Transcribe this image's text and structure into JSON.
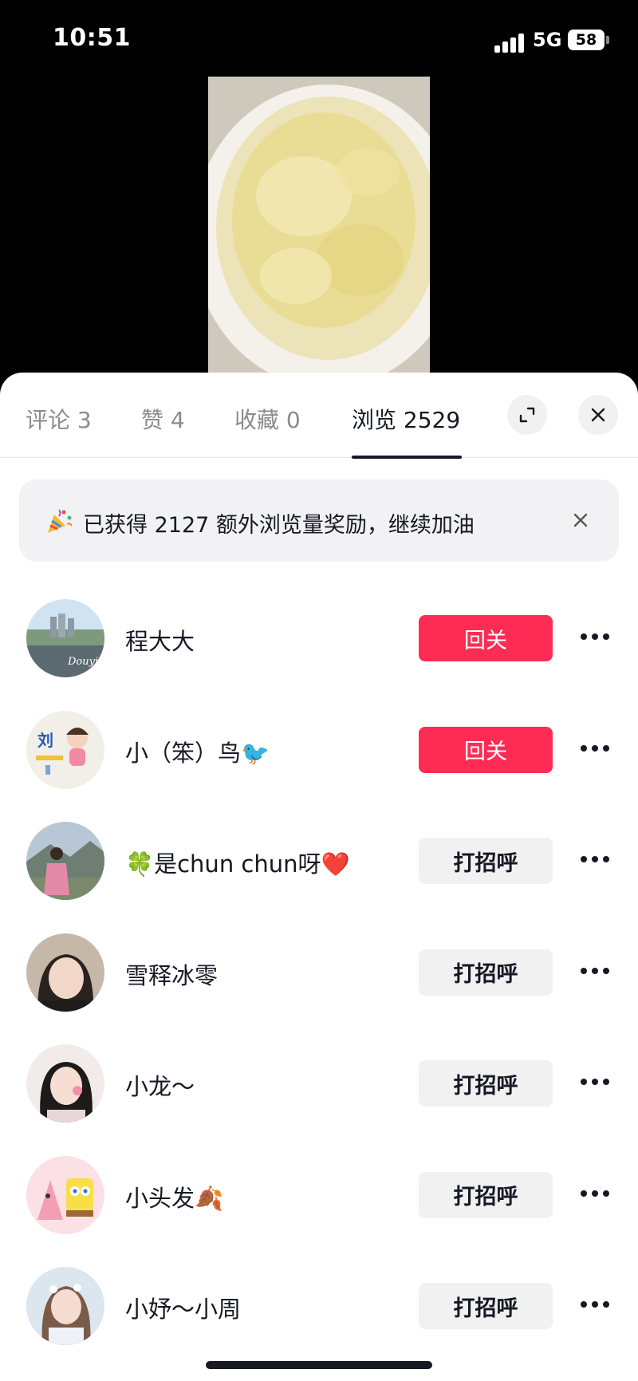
{
  "status_bar": {
    "time": "10:51",
    "network": "5G",
    "battery": "58"
  },
  "tabs": [
    {
      "label": "评论 3"
    },
    {
      "label": "赞 4"
    },
    {
      "label": "收藏 0"
    },
    {
      "label": "浏览 2529",
      "active": true
    }
  ],
  "controls": {
    "expand_icon": "expand-icon",
    "close_icon": "close-icon"
  },
  "banner": {
    "icon": "party-popper-icon",
    "text": "已获得 2127 额外浏览量奖励，继续加油",
    "close_icon": "close-icon"
  },
  "viewers": [
    {
      "name": "程大大",
      "action": "回关",
      "action_type": "follow"
    },
    {
      "name": "小（笨）鸟🐦",
      "action": "回关",
      "action_type": "follow"
    },
    {
      "name": "🍀是chun chun呀❤️",
      "action": "打招呼",
      "action_type": "greet"
    },
    {
      "name": "雪释冰零",
      "action": "打招呼",
      "action_type": "greet"
    },
    {
      "name": "小龙～",
      "action": "打招呼",
      "action_type": "greet"
    },
    {
      "name": "小头发🍂",
      "action": "打招呼",
      "action_type": "greet"
    },
    {
      "name": "小妤～小周",
      "action": "打招呼",
      "action_type": "greet"
    }
  ],
  "colors": {
    "accent": "#fe2c55",
    "text": "#161823",
    "muted": "#8a8b91",
    "chip": "#f1f1f2"
  }
}
